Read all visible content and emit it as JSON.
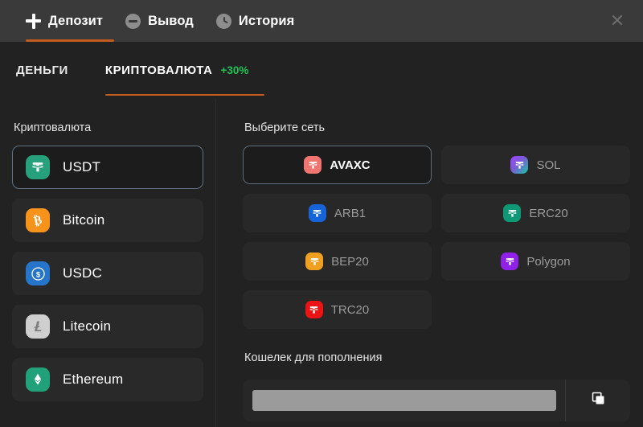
{
  "window": {
    "close_label": "✕"
  },
  "topnav": [
    {
      "label": "Депозит",
      "icon": "plus-icon",
      "active": true
    },
    {
      "label": "Вывод",
      "icon": "minus-circle-icon",
      "active": false
    },
    {
      "label": "История",
      "icon": "clock-icon",
      "active": false
    }
  ],
  "subtabs": [
    {
      "label": "ДЕНЬГИ",
      "badge": "",
      "active": false
    },
    {
      "label": "КРИПТОВАЛЮТА",
      "badge": "+30%",
      "active": true
    }
  ],
  "left_panel": {
    "title": "Криптовалюта",
    "items": [
      {
        "name": "USDT",
        "icon": "usdt-icon",
        "color": "#26a17b",
        "selected": true
      },
      {
        "name": "Bitcoin",
        "icon": "bitcoin-icon",
        "color": "#f7931a",
        "selected": false
      },
      {
        "name": "USDC",
        "icon": "usdc-icon",
        "color": "#2775ca",
        "selected": false
      },
      {
        "name": "Litecoin",
        "icon": "litecoin-icon",
        "color": "#cfcfcf",
        "selected": false
      },
      {
        "name": "Ethereum",
        "icon": "ethereum-icon",
        "color": "#21a179",
        "selected": false
      }
    ]
  },
  "right_panel": {
    "title": "Выберите сеть",
    "networks": [
      {
        "label": "AVAXC",
        "icon": "tether-icon",
        "color": "#f07470",
        "selected": true
      },
      {
        "label": "SOL",
        "icon": "tether-icon",
        "color": "#8b46c4",
        "selected": false
      },
      {
        "label": "ARB1",
        "icon": "tether-icon",
        "color": "#1565d8",
        "selected": false
      },
      {
        "label": "ERC20",
        "icon": "tether-icon",
        "color": "#0f9875",
        "selected": false
      },
      {
        "label": "BEP20",
        "icon": "tether-icon",
        "color": "#f0a020",
        "selected": false
      },
      {
        "label": "Polygon",
        "icon": "tether-icon",
        "color": "#8f21e8",
        "selected": false
      },
      {
        "label": "TRC20",
        "icon": "tether-icon",
        "color": "#ea1414",
        "selected": false
      }
    ],
    "wallet": {
      "title": "Кошелек для пополнения",
      "address": "",
      "copy_icon": "copy-icon"
    }
  },
  "colors": {
    "accent": "#c25b1e",
    "badge_green": "#1fc355",
    "topbar_bg": "#3a3a3a",
    "body_bg": "#222222",
    "card_bg": "#292929",
    "selected_border": "#63707f"
  }
}
